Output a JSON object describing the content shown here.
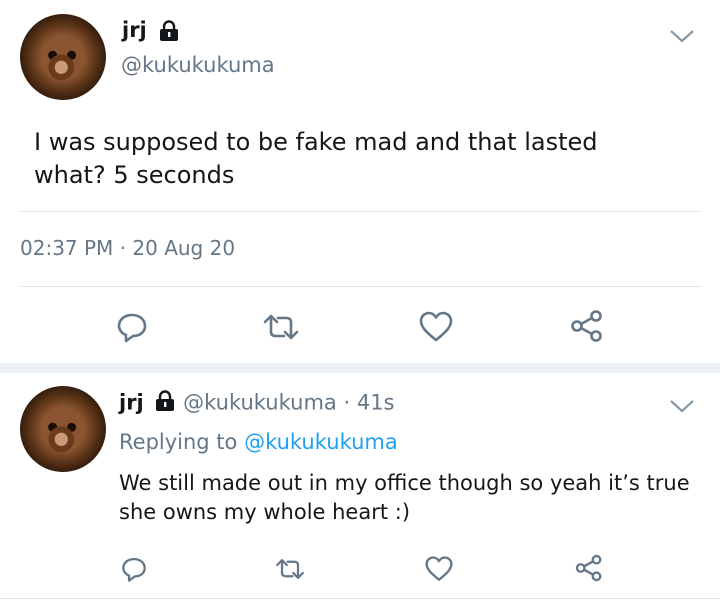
{
  "tweet": {
    "name": "jrj",
    "handle": "@kukukukuma",
    "text_line1": "I was supposed to be fake mad and that lasted",
    "text_line2": "what? 5 seconds",
    "time": "02:37 PM",
    "sep": "·",
    "date": "20 Aug 20"
  },
  "reply": {
    "name": "jrj",
    "handle": "@kukukukuma",
    "sep": "·",
    "age": "41s",
    "replying_prefix": "Replying to",
    "replying_handle": "@kukukukuma",
    "text_line1": "We still made out in my office though so yeah it’s true",
    "text_line2": "she owns my whole heart :)"
  },
  "icons": {
    "reply": "reply-icon",
    "retweet": "retweet-icon",
    "like": "heart-icon",
    "share": "share-icon",
    "lock": "lock-icon",
    "menu": "chevron-down-icon"
  },
  "colors": {
    "secondary": "#657786",
    "link": "#1da1f2",
    "divider": "#e1e8ed"
  }
}
